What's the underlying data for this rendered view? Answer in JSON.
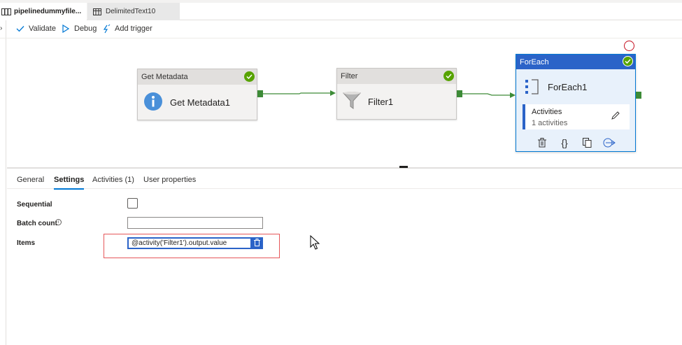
{
  "tabs": [
    {
      "label": "pipelinedummyfile...",
      "close": "✕",
      "icon": "pipeline-icon"
    },
    {
      "label": "DelimitedText10",
      "icon": "table-icon"
    }
  ],
  "toolbar": {
    "validate": "Validate",
    "debug": "Debug",
    "add_trigger": "Add trigger"
  },
  "activities": {
    "get_metadata": {
      "type": "Get Metadata",
      "name": "Get Metadata1",
      "icon": "info-icon"
    },
    "filter": {
      "type": "Filter",
      "name": "Filter1",
      "icon": "funnel-icon"
    },
    "foreach": {
      "type": "ForEach",
      "name": "ForEach1",
      "inner_label": "Activities",
      "inner_count": "1 activities",
      "icon": "foreach-icon"
    }
  },
  "panel_tabs": [
    "General",
    "Settings",
    "Activities (1)",
    "User properties"
  ],
  "selected_panel_tab": "Settings",
  "settings": {
    "sequential_label": "Sequential",
    "sequential_checked": false,
    "batch_count_label": "Batch count",
    "batch_count_value": "",
    "items_label": "Items",
    "items_value": "@activity('Filter1').output.value"
  },
  "colors": {
    "accent": "#0078d4",
    "foreach_header": "#2b63c8",
    "success": "#57a300",
    "port": "#3d8b37",
    "highlight_border": "#e6575a"
  }
}
